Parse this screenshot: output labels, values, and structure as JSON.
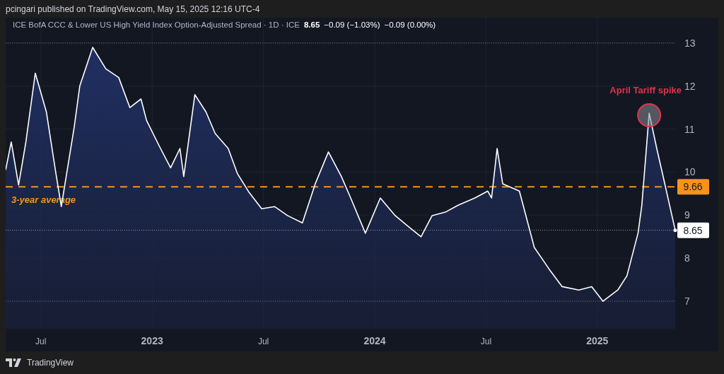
{
  "header": {
    "text": "pcingari published on TradingView.com, May 15, 2025 12:16 UTC-4"
  },
  "legend": {
    "title": "ICE BofA CCC & Lower US High Yield Index Option-Adjusted Spread · 1D · ICE",
    "value": "8.65",
    "change": "−0.09 (−1.03%)",
    "change_2": "−0.09 (0.00%)"
  },
  "chart": {
    "average_line": {
      "tag": "9.66"
    },
    "last_price": {
      "tag": "8.65"
    },
    "chart_data": {
      "type": "area",
      "grid": true,
      "xlim": [
        2022.342,
        2025.35
      ],
      "ylim": [
        6.36,
        13.59
      ],
      "yticks": [
        7,
        8,
        9,
        10,
        11,
        12,
        13
      ],
      "xticks": [
        {
          "value": 2022.5,
          "label": "Jul"
        },
        2023,
        {
          "value": 2023.5,
          "label": "Jul"
        },
        2024,
        {
          "value": 2024.5,
          "label": "Jul"
        },
        2025
      ],
      "x": [
        2022.342,
        2022.367,
        2022.4,
        2022.433,
        2022.475,
        2022.525,
        2022.567,
        2022.592,
        2022.65,
        2022.675,
        2022.733,
        2022.792,
        2022.85,
        2022.9,
        2022.95,
        2022.975,
        2023.033,
        2023.083,
        2023.125,
        2023.142,
        2023.192,
        2023.242,
        2023.283,
        2023.342,
        2023.383,
        2023.433,
        2023.492,
        2023.55,
        2023.608,
        2023.675,
        2023.733,
        2023.792,
        2023.85,
        2023.892,
        2023.958,
        2024.025,
        2024.092,
        2024.15,
        2024.208,
        2024.258,
        2024.317,
        2024.375,
        2024.45,
        2024.508,
        2024.525,
        2024.55,
        2024.575,
        2024.65,
        2024.717,
        2024.783,
        2024.842,
        2024.917,
        2024.975,
        2025.025,
        2025.092,
        2025.133,
        2025.183,
        2025.2,
        2025.233,
        2025.267,
        2025.3,
        2025.35
      ],
      "series": [
        {
          "color": "#ffffff",
          "values": [
            10.05,
            10.7,
            9.7,
            10.7,
            12.3,
            11.4,
            10.0,
            9.2,
            11.05,
            12.0,
            12.9,
            12.4,
            12.2,
            11.5,
            11.7,
            11.2,
            10.6,
            10.1,
            10.55,
            9.9,
            11.8,
            11.4,
            10.9,
            10.55,
            9.97,
            9.55,
            9.15,
            9.2,
            8.99,
            8.82,
            9.73,
            10.47,
            9.9,
            9.4,
            8.58,
            9.4,
            8.99,
            8.74,
            8.5,
            8.99,
            9.07,
            9.23,
            9.4,
            9.56,
            9.4,
            10.55,
            9.73,
            9.56,
            8.25,
            7.75,
            7.34,
            7.26,
            7.34,
            7.0,
            7.26,
            7.59,
            8.58,
            9.23,
            11.37,
            10.55,
            9.8,
            8.65
          ]
        },
        {
          "name": "3-year average",
          "type": "line",
          "line_style": "dashed",
          "color": "#f7931a",
          "values": [
            9.66,
            9.66,
            9.66,
            9.66,
            9.66,
            9.66,
            9.66,
            9.66,
            9.66,
            9.66,
            9.66,
            9.66,
            9.66,
            9.66,
            9.66,
            9.66,
            9.66,
            9.66,
            9.66,
            9.66,
            9.66,
            9.66,
            9.66,
            9.66,
            9.66,
            9.66,
            9.66,
            9.66,
            9.66,
            9.66,
            9.66,
            9.66,
            9.66,
            9.66,
            9.66,
            9.66,
            9.66,
            9.66,
            9.66,
            9.66,
            9.66,
            9.66,
            9.66,
            9.66,
            9.66,
            9.66,
            9.66,
            9.66,
            9.66,
            9.66,
            9.66,
            9.66,
            9.66,
            9.66,
            9.66,
            9.66,
            9.66,
            9.66,
            9.66,
            9.66,
            9.66,
            9.66
          ]
        },
        {
          "type": "line",
          "line_style": "dotted",
          "color": "#9aa0ad",
          "values": [
            8.65,
            8.65,
            8.65,
            8.65,
            8.65,
            8.65,
            8.65,
            8.65,
            8.65,
            8.65,
            8.65,
            8.65,
            8.65,
            8.65,
            8.65,
            8.65,
            8.65,
            8.65,
            8.65,
            8.65,
            8.65,
            8.65,
            8.65,
            8.65,
            8.65,
            8.65,
            8.65,
            8.65,
            8.65,
            8.65,
            8.65,
            8.65,
            8.65,
            8.65,
            8.65,
            8.65,
            8.65,
            8.65,
            8.65,
            8.65,
            8.65,
            8.65,
            8.65,
            8.65,
            8.65,
            8.65,
            8.65,
            8.65,
            8.65,
            8.65,
            8.65,
            8.65,
            8.65,
            8.65,
            8.65,
            8.65,
            8.65,
            8.65,
            8.65,
            8.65,
            8.65,
            8.65
          ]
        }
      ],
      "annotations": [
        {
          "text": "April Tariff spike",
          "x": 2025.233,
          "y": 11.37
        }
      ]
    }
  },
  "footer": {
    "brand": "TradingView"
  }
}
